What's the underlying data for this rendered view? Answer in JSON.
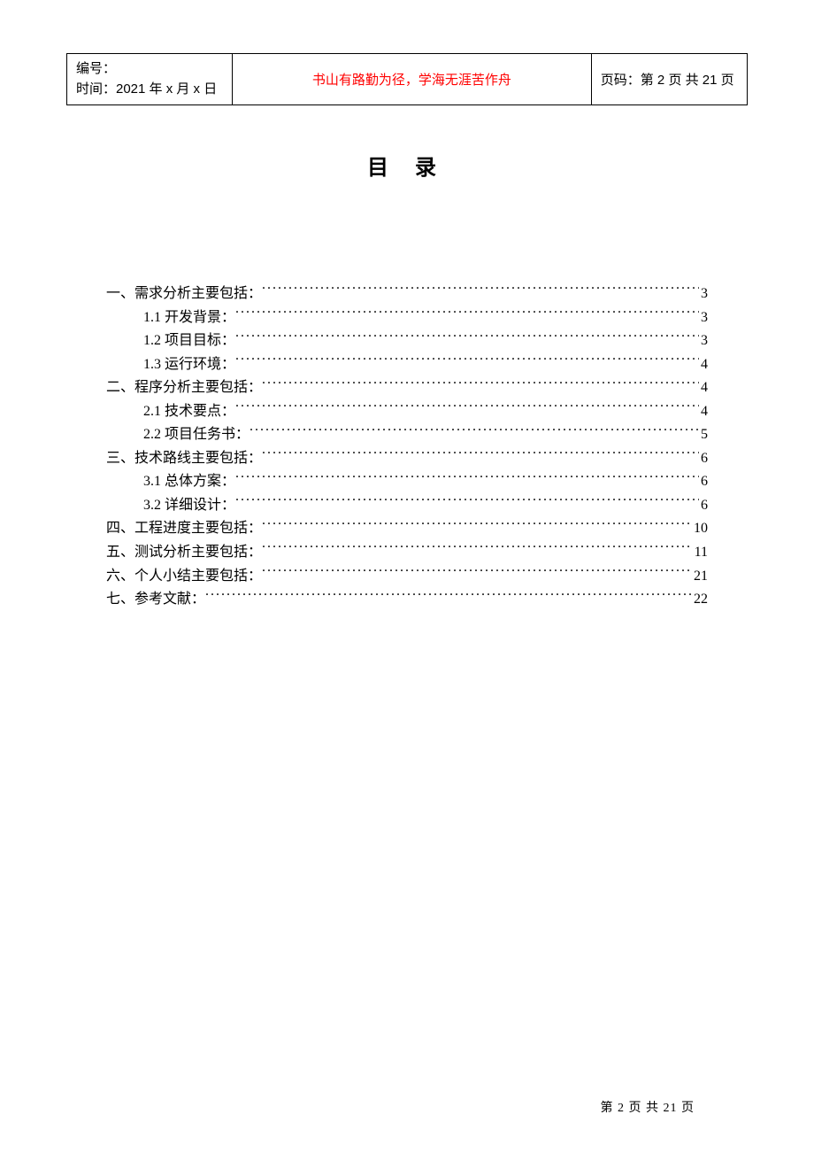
{
  "header": {
    "id_label": "编号：",
    "date_label": "时间：2021 年 x 月 x 日",
    "motto": "书山有路勤为径，学海无涯苦作舟",
    "page_label": "页码：第 2 页 共 21 页"
  },
  "title": "目 录",
  "toc": [
    {
      "level": 1,
      "label": "一、需求分析主要包括：",
      "page": "3"
    },
    {
      "level": 2,
      "label": "1.1 开发背景：",
      "page": "3"
    },
    {
      "level": 2,
      "label": "1.2 项目目标：",
      "page": "3"
    },
    {
      "level": 2,
      "label": "1.3 运行环境：",
      "page": "4"
    },
    {
      "level": 1,
      "label": "二、程序分析主要包括：",
      "page": "4"
    },
    {
      "level": 2,
      "label": "2.1 技术要点：",
      "page": "4"
    },
    {
      "level": 2,
      "label": "2.2 项目任务书：",
      "page": "5"
    },
    {
      "level": 1,
      "label": "三、技术路线主要包括：",
      "page": "6"
    },
    {
      "level": 2,
      "label": "3.1 总体方案：",
      "page": "6"
    },
    {
      "level": 2,
      "label": "3.2 详细设计：",
      "page": "6"
    },
    {
      "level": 1,
      "label": "四、工程进度主要包括：",
      "page": "10"
    },
    {
      "level": 1,
      "label": "五、测试分析主要包括：",
      "page": "11"
    },
    {
      "level": 1,
      "label": "六、个人小结主要包括：",
      "page": "21"
    },
    {
      "level": 1,
      "label": "七、参考文献：",
      "page": "22"
    }
  ],
  "footer": "第 2 页 共 21 页"
}
